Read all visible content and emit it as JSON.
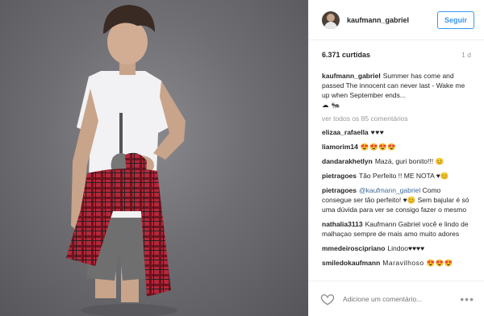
{
  "header": {
    "username": "kaufmann_gabriel",
    "follow_label": "Seguir"
  },
  "stats": {
    "likes": "6.371 curtidas",
    "time": "1 d"
  },
  "caption": {
    "user": "kaufmann_gabriel",
    "text": "Summer has come and passed The innocent can never last - Wake me up when September ends...",
    "emoji": "☁ 🐜"
  },
  "view_all_label": "ver todos os 85 comentários",
  "comments": [
    {
      "user": "elizaa_rafaella",
      "text": "♥♥♥"
    },
    {
      "user": "liamorim14",
      "text": "😍😍😍😍"
    },
    {
      "user": "dandarakhetlyn",
      "text": "Mazá, guri bonito!!! 😊"
    },
    {
      "user": "pietragoes",
      "text": "Tão Perfeito !! ME NOTA ♥😊"
    },
    {
      "user": "pietragoes",
      "mention": "@kaufmann_gabriel",
      "text": "Como consegue ser tão perfeito! ♥😊 Sem bajular é só uma dúvida para ver se consigo fazer o mesmo"
    },
    {
      "user": "nathalia3113",
      "text": "Kaufmann Gabriel você e lindo de malhaçao sempre de mais amo muito adores"
    },
    {
      "user": "mmedeiroscipriano",
      "text": "Lindoo♥♥♥♥"
    },
    {
      "user": "smiledokaufmann",
      "text": "Maravilhoso 😍😍😍"
    }
  ],
  "footer": {
    "add_comment_placeholder": "Adicione um comentário...",
    "more_label": "•••"
  },
  "colors": {
    "accent": "#3897f0",
    "text": "#262626",
    "muted": "#999999"
  }
}
